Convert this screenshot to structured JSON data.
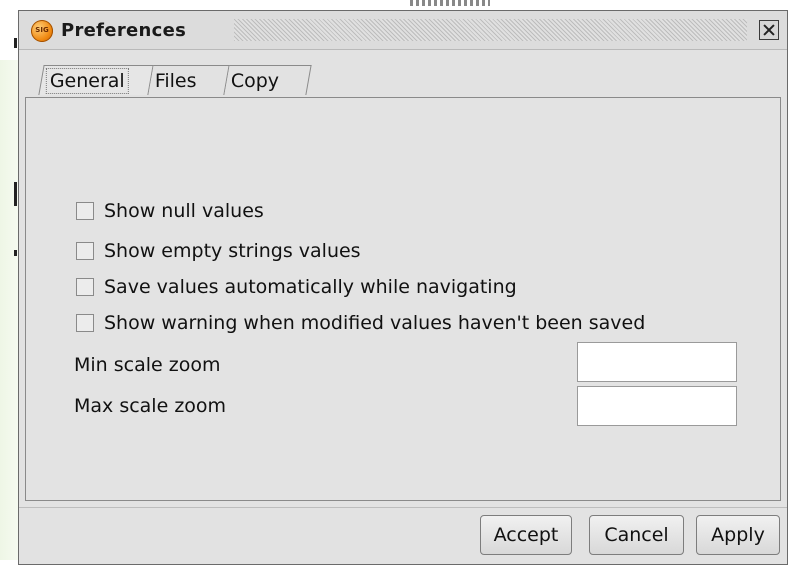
{
  "window": {
    "title": "Preferences",
    "icon_text": "SIG"
  },
  "tabs": [
    {
      "label": "General",
      "active": true
    },
    {
      "label": "Files",
      "active": false
    },
    {
      "label": "Copy",
      "active": false
    }
  ],
  "general": {
    "checkboxes": [
      {
        "label": "Show null values",
        "checked": false
      },
      {
        "label": "Show empty strings values",
        "checked": false
      },
      {
        "label": "Save values automatically while navigating",
        "checked": false
      },
      {
        "label": "Show warning when modified values haven't been saved",
        "checked": false
      }
    ],
    "fields": [
      {
        "label": "Min scale zoom",
        "value": ""
      },
      {
        "label": "Max scale zoom",
        "value": ""
      }
    ]
  },
  "buttons": {
    "accept": "Accept",
    "cancel": "Cancel",
    "apply": "Apply"
  },
  "colors": {
    "window_bg": "#e2e2e2",
    "app_icon": "#f08a12"
  }
}
